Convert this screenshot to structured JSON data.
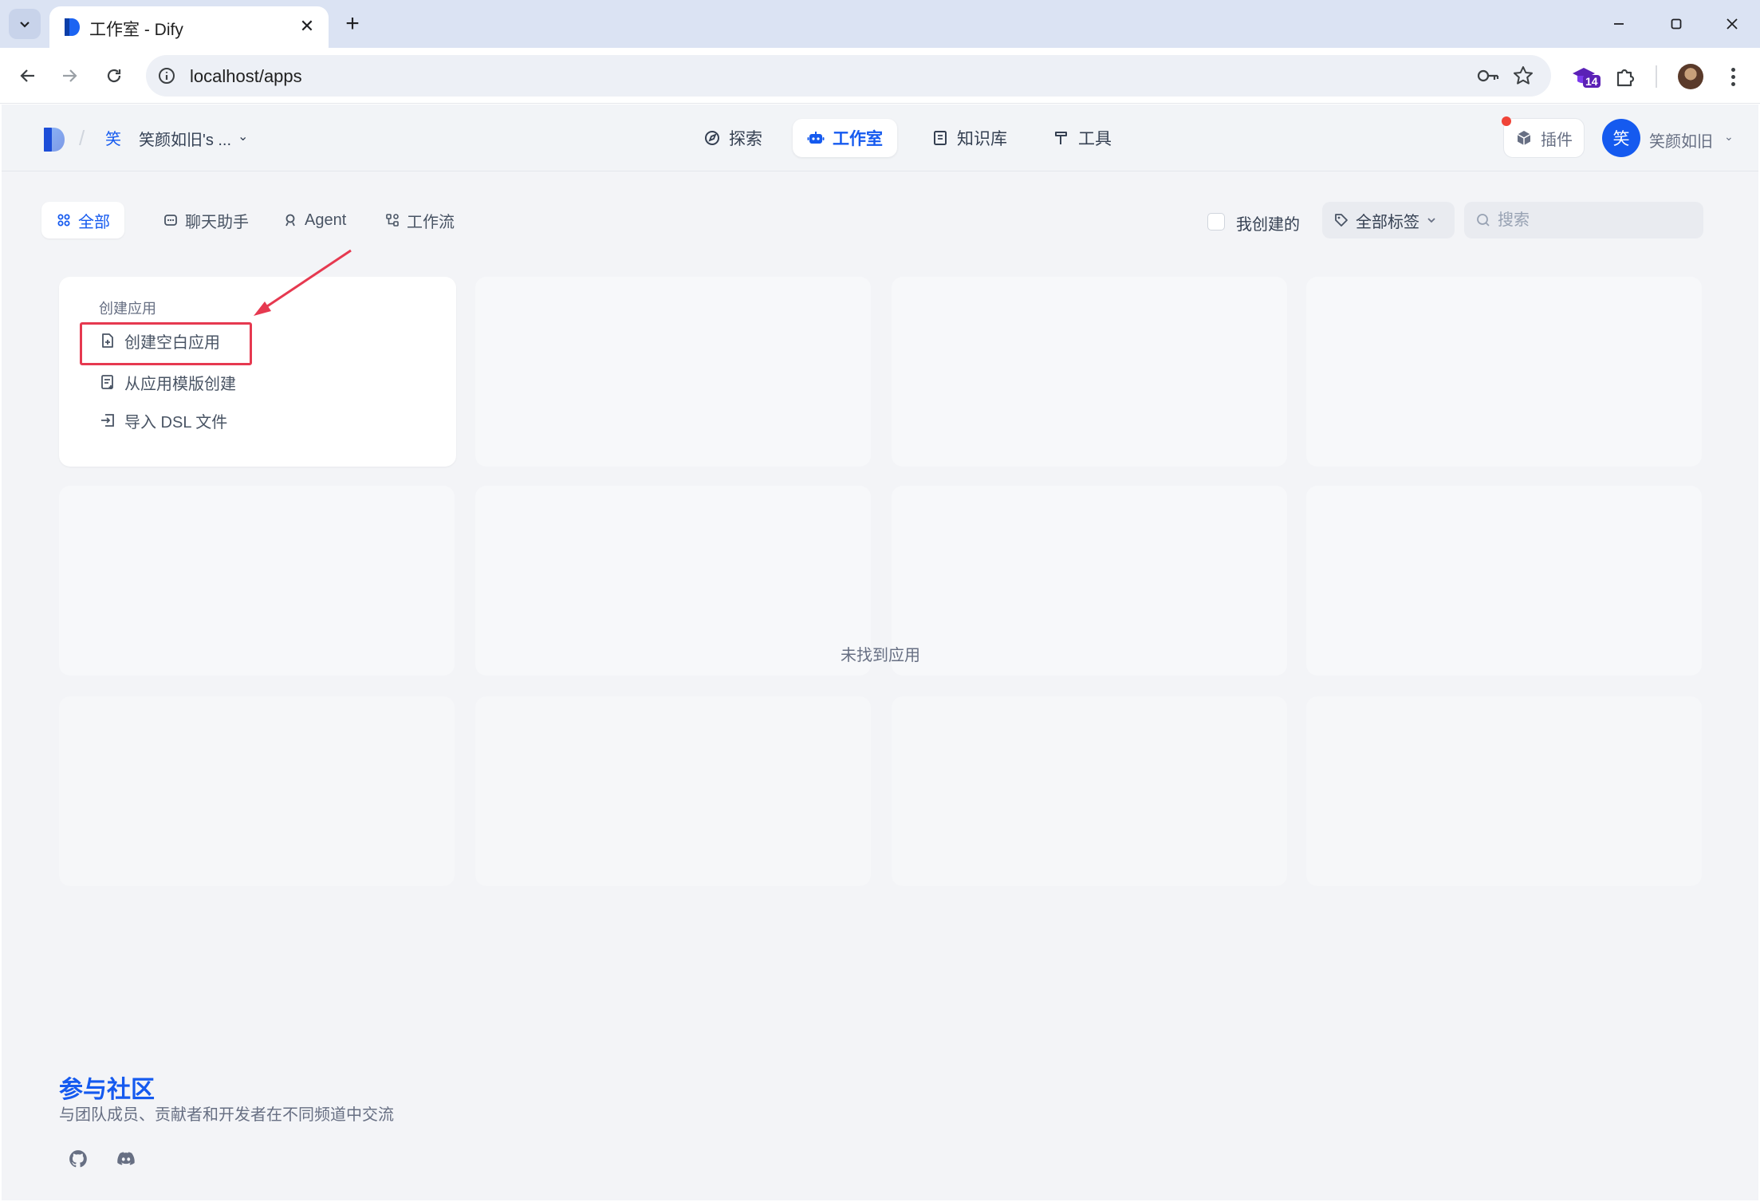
{
  "browser": {
    "tab_title": "工作室 - Dify",
    "url": "localhost/apps",
    "extension_badge": "14"
  },
  "header": {
    "workspace_initial": "笑",
    "workspace_name": "笑颜如旧's ...",
    "nav": [
      "探索",
      "工作室",
      "知识库",
      "工具"
    ],
    "active_nav": "工作室",
    "plugin_label": "插件",
    "user_initial": "笑",
    "user_name": "笑颜如旧"
  },
  "filters": {
    "tabs": [
      "全部",
      "聊天助手",
      "Agent",
      "工作流"
    ],
    "active_tab": "全部",
    "created_by_me": "我创建的",
    "tags_label": "全部标签",
    "search_placeholder": "搜索"
  },
  "create_card": {
    "title": "创建应用",
    "items": [
      "创建空白应用",
      "从应用模版创建",
      "导入 DSL 文件"
    ]
  },
  "empty_state": "未找到应用",
  "community": {
    "title": "参与社区",
    "description": "与团队成员、贡献者和开发者在不同频道中交流"
  },
  "colors": {
    "accent": "#155aef",
    "annotation": "#e63950",
    "background": "#f3f4f7"
  },
  "icons": [
    "search-icon",
    "github-icon",
    "discord-icon",
    "compass-icon",
    "robot-icon",
    "book-icon",
    "hammer-icon",
    "cube-icon",
    "tag-icon"
  ]
}
